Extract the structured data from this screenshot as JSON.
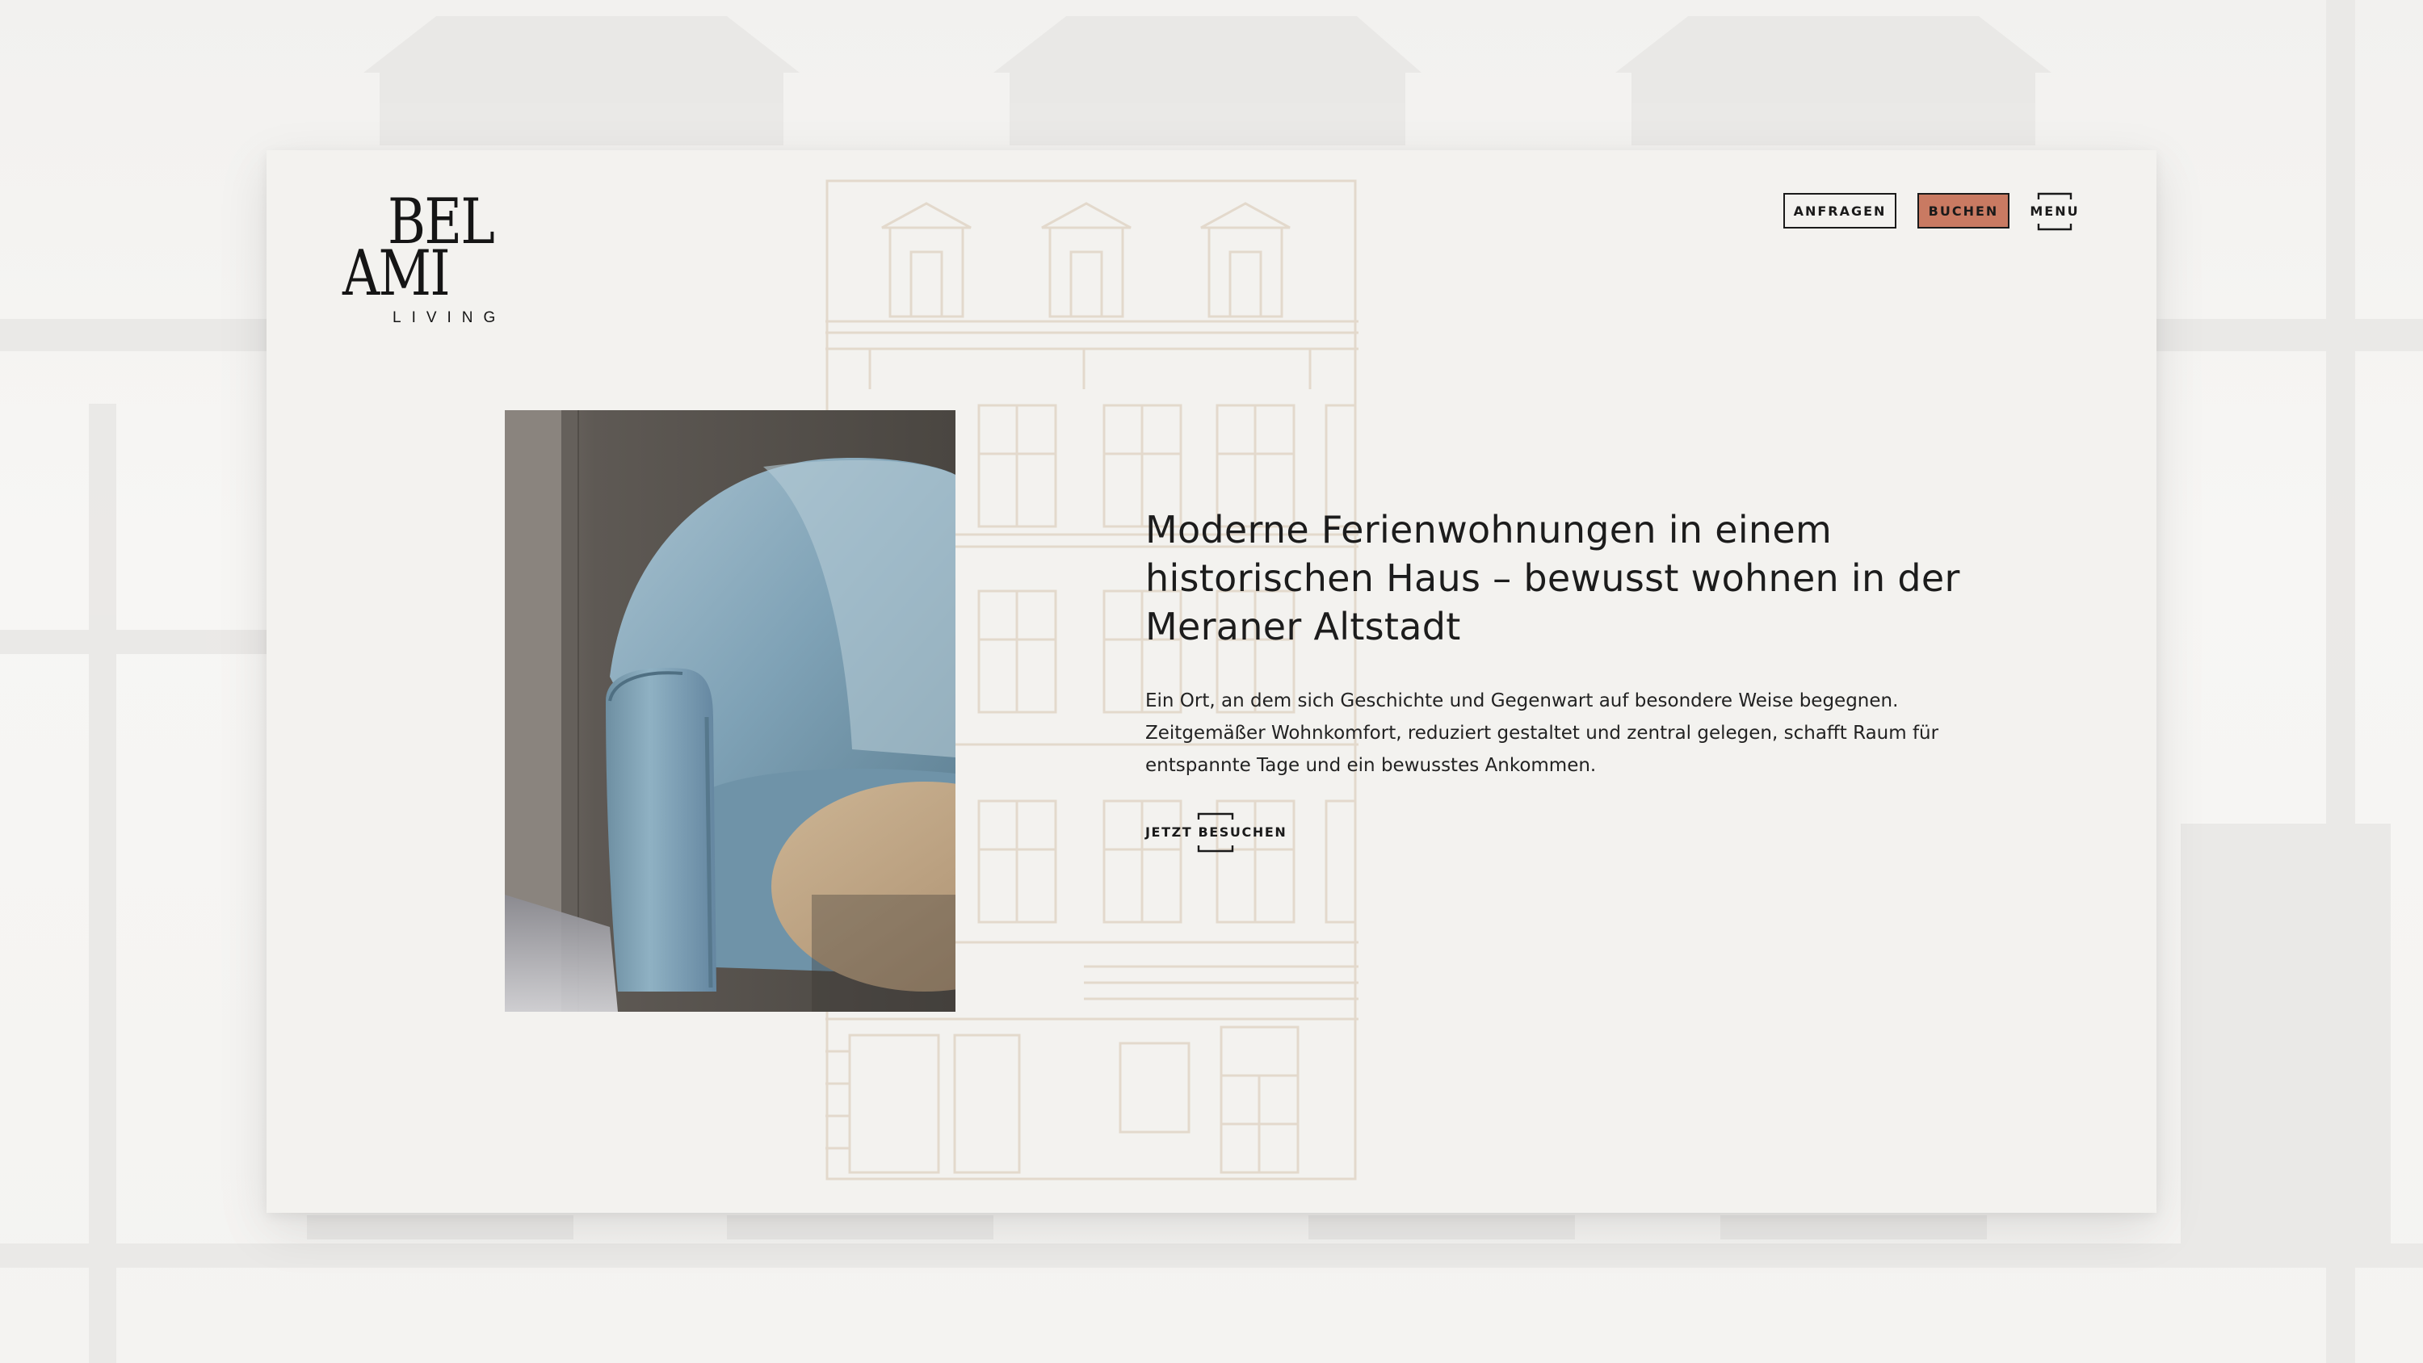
{
  "brand": {
    "line1": "BEL",
    "line2": "AMI",
    "line3": "LIVING"
  },
  "header": {
    "anfragen_label": "ANFRAGEN",
    "buchen_label": "BUCHEN",
    "menu_label": "MENU"
  },
  "hero": {
    "headline": "Moderne Ferienwohnungen in einem historischen Haus – bewusst wohnen in der Meraner Altstadt",
    "body": "Ein Ort, an dem sich Geschichte und Gegenwart auf besondere Weise begegnen. Zeitgemäßer Wohnkomfort, reduziert gestaltet und zentral gelegen, schafft Raum für entspannte Tage und ein bewusstes Ankommen.",
    "cta_label": "JETZT BESUCHEN",
    "image_subject": "blue-armchair-photo"
  },
  "colors": {
    "card_bg": "#f3f2ef",
    "accent": "#c97a62",
    "text": "#1c1c1c",
    "line_art": "#e3d9cc"
  }
}
